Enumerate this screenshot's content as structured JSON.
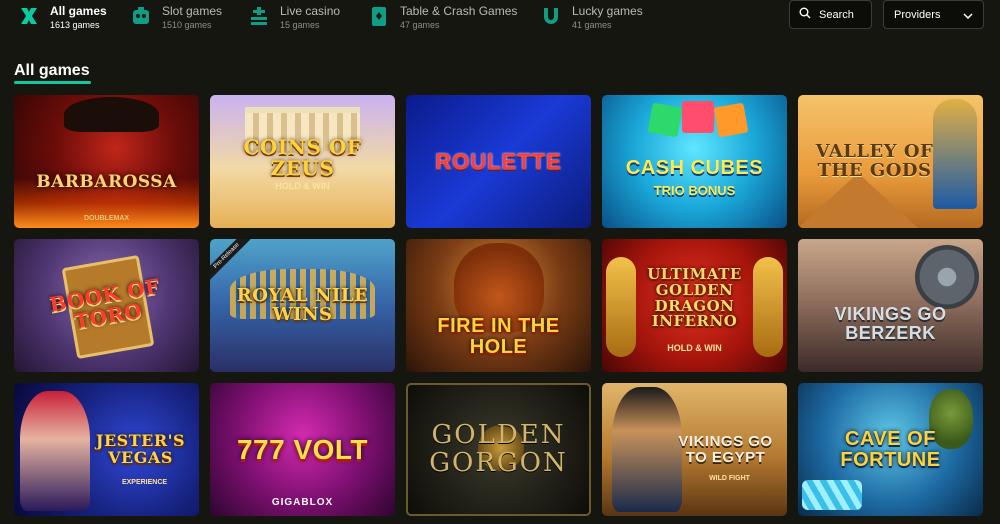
{
  "categories": [
    {
      "label": "All games",
      "count": "1613 games",
      "icon": "grid-icon",
      "active": true
    },
    {
      "label": "Slot games",
      "count": "1510 games",
      "icon": "slot-machine-icon"
    },
    {
      "label": "Live casino",
      "count": "15 games",
      "icon": "roulette-table-icon"
    },
    {
      "label": "Table & Crash Games",
      "count": "47 games",
      "icon": "card-icon"
    },
    {
      "label": "Lucky games",
      "count": "41 games",
      "icon": "horseshoe-icon"
    }
  ],
  "search": {
    "label": "Search",
    "icon": "search-icon"
  },
  "providers": {
    "label": "Providers",
    "icon": "chevron-down-icon"
  },
  "section": {
    "title": "All games"
  },
  "colors": {
    "accent": "#10c8a2",
    "background": "#15160f"
  },
  "games": [
    {
      "name": "Barbarossa",
      "sub": "DoubleMax"
    },
    {
      "name": "Coins of Zeus",
      "sub": "Hold & Win"
    },
    {
      "name": "Roulette"
    },
    {
      "name": "Cash Cubes",
      "sub": "Trio Bonus"
    },
    {
      "name": "Valley of the Gods"
    },
    {
      "name": "Book of Toro"
    },
    {
      "name": "Royal Nile Wins",
      "badge": "Pre-Release"
    },
    {
      "name": "Fire in the Hole"
    },
    {
      "name": "Ultimate Golden Dragon Inferno",
      "sub": "Hold & Win"
    },
    {
      "name": "Vikings Go Berzerk"
    },
    {
      "name": "Jester's Vegas",
      "sub": "Experience"
    },
    {
      "name": "777 Volt",
      "sub": "GigaBlox"
    },
    {
      "name": "Golden Gorgon"
    },
    {
      "name": "Vikings Go to Egypt",
      "sub": "Wild Fight"
    },
    {
      "name": "Cave of Fortune"
    }
  ]
}
